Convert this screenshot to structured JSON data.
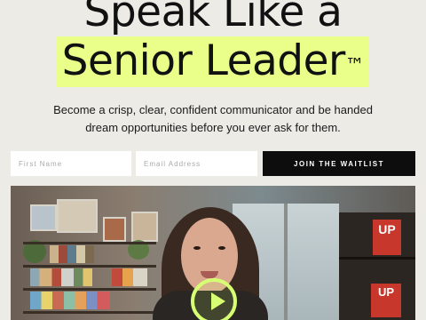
{
  "hero": {
    "title_line1": "Speak Like a",
    "title_line2": "Senior Leader",
    "trademark": "™",
    "subtitle": "Become a crisp, clear, confident communicator and be handed dream opportunities before you ever ask for them.",
    "highlight_color": "#e9ff8a"
  },
  "form": {
    "first_name_placeholder": "First Name",
    "email_placeholder": "Email Address",
    "submit_label": "JOIN THE WAITLIST"
  },
  "video": {
    "play_icon": "play-icon",
    "accent_color": "#d6ff73",
    "book_text": "UP"
  }
}
